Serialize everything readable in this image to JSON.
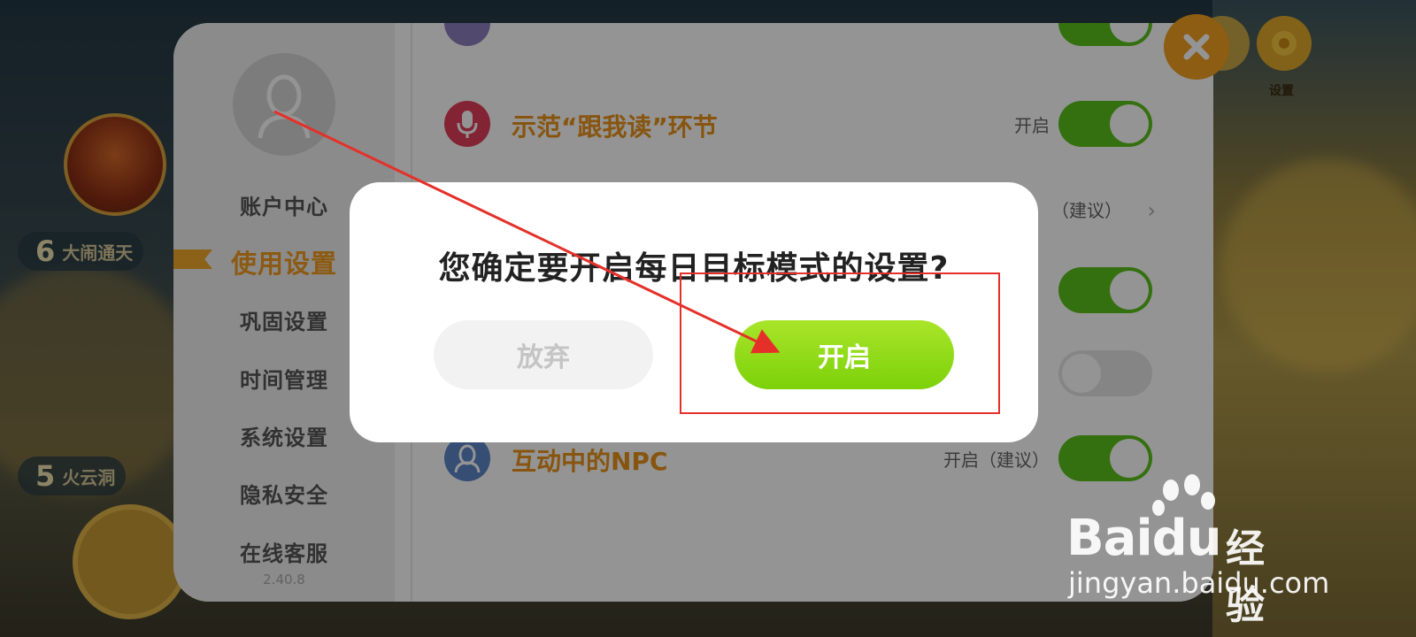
{
  "background": {
    "level_badges": [
      {
        "number": "6",
        "text": "大闹通天"
      },
      {
        "number": "5",
        "text": "火云洞"
      }
    ],
    "top_icons": [
      {
        "label": "",
        "icon": "map-icon"
      },
      {
        "label": "设置",
        "icon": "gear-icon"
      }
    ],
    "bottom_labels": [
      "",
      "",
      "",
      "",
      ""
    ]
  },
  "panel": {
    "sidebar": {
      "menu": [
        {
          "label": "账户中心",
          "active": false
        },
        {
          "label": "使用设置",
          "active": true
        },
        {
          "label": "巩固设置",
          "active": false
        },
        {
          "label": "时间管理",
          "active": false
        },
        {
          "label": "系统设置",
          "active": false
        },
        {
          "label": "隐私安全",
          "active": false
        },
        {
          "label": "在线客服",
          "active": false
        }
      ],
      "version": "2.40.8"
    },
    "settings": [
      {
        "label": "示范“跟我读”环节",
        "status": "开启",
        "toggle": "on",
        "icon": "microphone-icon"
      },
      {
        "label": "",
        "status": "（建议）",
        "toggle": "none",
        "icon": ""
      },
      {
        "label": "",
        "status": "",
        "toggle": "on",
        "icon": ""
      },
      {
        "label": "",
        "status": "",
        "toggle": "off",
        "icon": ""
      },
      {
        "label": "互动中的NPC",
        "status": "开启（建议）",
        "toggle": "on",
        "icon": "npc-icon"
      }
    ]
  },
  "dialog": {
    "title": "您确定要开启每日目标模式的设置?",
    "cancel_label": "放弃",
    "confirm_label": "开启"
  },
  "watermark": {
    "logo": "Baidu",
    "name": "经验",
    "url": "jingyan.baidu.com"
  },
  "colors": {
    "accent": "#F29B1E",
    "toggle_on": "#5CC21C",
    "confirm_green": "#8FD914",
    "annotation_red": "#E5302A"
  }
}
